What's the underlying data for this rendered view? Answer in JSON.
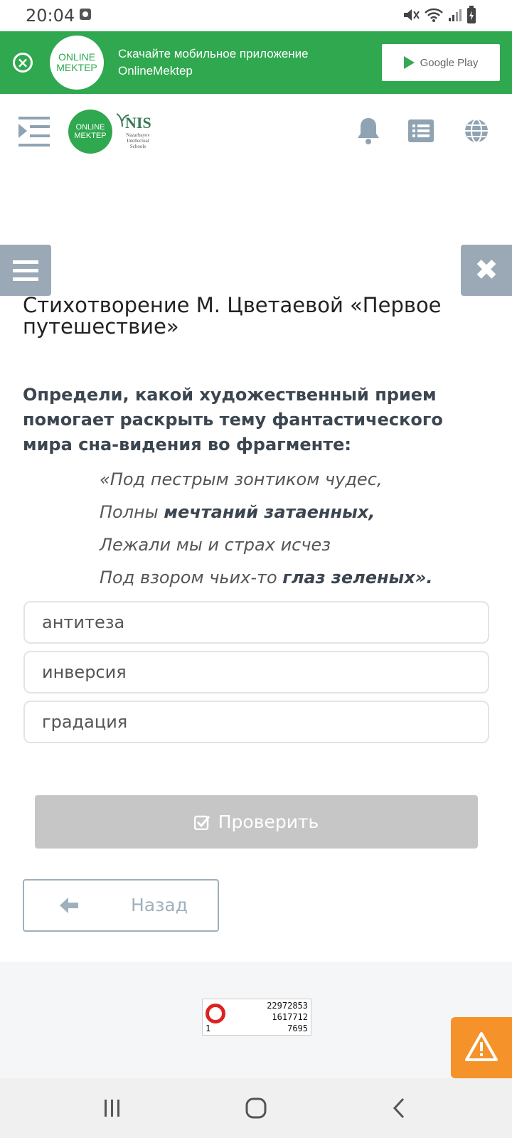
{
  "status_bar": {
    "time": "20:04"
  },
  "promo_banner": {
    "logo_line1": "ONLINE",
    "logo_line2": "MEKTEP",
    "text": "Скачайте мобильное приложение OnlineMektep",
    "store_button": "Google Play"
  },
  "header": {
    "logo_line1": "ONLINE",
    "logo_line2": "MEKTEP",
    "nis_title": "NIS",
    "nis_subtitle": [
      "Nazarbayev",
      "Intellectual",
      "Schools"
    ]
  },
  "lesson": {
    "title": "Стихотворение М. Цветаевой «Первое путешествие»",
    "question": "Определи, какой художественный прием помогает раскрыть тему фантастического мира сна-видения во фрагменте:",
    "poem": [
      {
        "plain": "«Под пестрым зонтиком чудес,",
        "bold": ""
      },
      {
        "plain": "Полны ",
        "bold": "мечтаний затаенных,"
      },
      {
        "plain": "Лежали мы и страх исчез",
        "bold": ""
      },
      {
        "plain": "Под взором чьих-то ",
        "bold": "глаз зеленых»."
      }
    ],
    "options": [
      "антитеза",
      "инверсия",
      "градация"
    ],
    "check_label": "Проверить",
    "back_label": "Назад"
  },
  "footer": {
    "counter": {
      "line1": "22972853",
      "line2": "1617712",
      "line3": "7695",
      "small": "1"
    }
  },
  "colors": {
    "brand_green": "#2fa84f",
    "side_button": "#9aa9b5",
    "disabled_button": "#c6c6c6",
    "warning": "#f5922a"
  }
}
